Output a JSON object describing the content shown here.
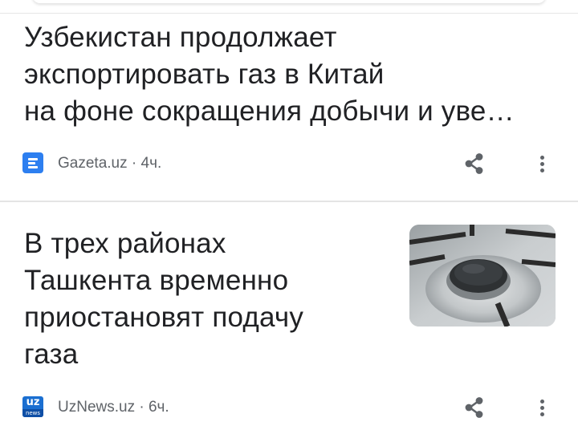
{
  "articles": [
    {
      "headline_lines": [
        "Узбекистан продолжает",
        "экспортировать газ в Китай",
        "на фоне сокращения добычи и уве…"
      ],
      "source": "Gazeta.uz",
      "separator": "·",
      "time": "4ч.",
      "favicon_icon": "gazeta-logo-icon"
    },
    {
      "headline_lines": [
        "В трех районах",
        "Ташкента временно",
        "приостановят подачу",
        "газа"
      ],
      "source": "UzNews.uz",
      "separator": "·",
      "time": "6ч.",
      "favicon_icon": "uznews-logo-icon",
      "favicon_text": {
        "top": "uz",
        "bottom": "news"
      },
      "thumbnail_icon": "gas-stove-burner-image"
    }
  ],
  "icons": {
    "share": "share-icon",
    "more": "more-vertical-icon"
  },
  "colors": {
    "headline": "#202124",
    "meta": "#5f6368",
    "gazeta_favicon": "#2d7ff0",
    "uznews_favicon": "#1b6fd1"
  }
}
